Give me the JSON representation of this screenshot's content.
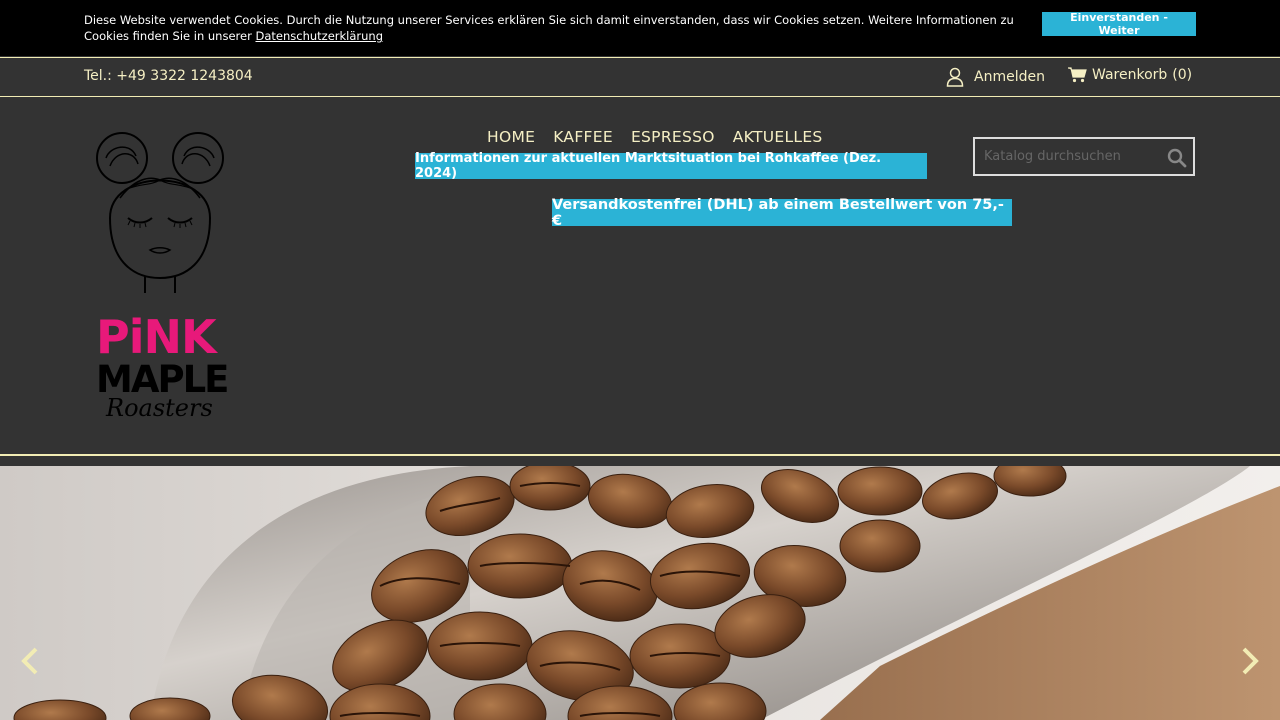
{
  "cookie": {
    "text": "Diese Website verwendet Cookies. Durch die Nutzung unserer Services erklären Sie sich damit einverstanden, dass wir Cookies setzen. Weitere Informationen zu Cookies finden Sie in unserer ",
    "link": "Datenschutzerklärung",
    "button": "Einverstanden - Weiter"
  },
  "topbar": {
    "phone": "Tel.: +49 3322 1243804",
    "login": "Anmelden",
    "cart": "Warenkorb",
    "cart_count": "(0)"
  },
  "logo": {
    "line1": "PiNK",
    "line2": "MAPLE",
    "line3": "Roasters"
  },
  "nav": {
    "items": [
      "HOME",
      "KAFFEE",
      "ESPRESSO",
      "AKTUELLES"
    ]
  },
  "market_link": "Informationen zur aktuellen Marktsituation bei Rohkaffee (Dez. 2024)",
  "shipping_banner": "Versandkostenfrei (DHL) ab einem Bestellwert von 75,-€",
  "search": {
    "placeholder": "Katalog durchsuchen"
  },
  "icons": {
    "login": "user-icon",
    "cart": "shopping-cart-icon",
    "search": "search-icon",
    "prev": "chevron-left-icon",
    "next": "chevron-right-icon"
  },
  "colors": {
    "accent": "#2bb3d6",
    "text_cream": "#f5efc4",
    "brand_pink": "#e8197a",
    "header_bg": "#333333"
  }
}
